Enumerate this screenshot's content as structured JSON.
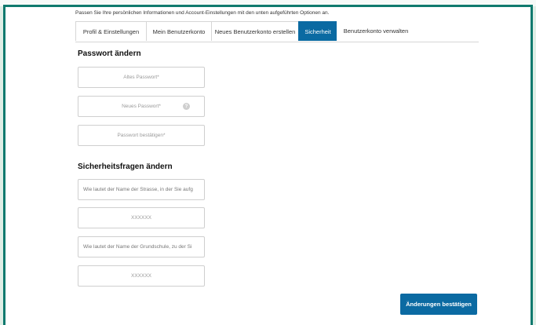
{
  "intro_text": "Passen Sie Ihre persönlichen Informationen und Account-Einstellungen mit den unten aufgeführten Optionen an.",
  "tabs": [
    {
      "label": "Profil & Einstellungen"
    },
    {
      "label": "Mein Benutzerkonto"
    },
    {
      "label": "Neues Benutzerkonto erstellen"
    },
    {
      "label": "Sicherheit",
      "active": true
    },
    {
      "label": "Benutzerkonto verwalten"
    }
  ],
  "password_section": {
    "title": "Passwort ändern",
    "old_password_placeholder": "Altes Passwort*",
    "new_password_placeholder": "Neues Passwort*",
    "confirm_password_placeholder": "Passwort bestätigen*",
    "help_glyph": "?"
  },
  "security_section": {
    "title": "Sicherheitsfragen ändern",
    "question1": "Wie lautet der Name der Strasse, in der Sie aufg",
    "answer1": "XXXXXX",
    "question2": "Wie lautet der Name der Grundschule, zu der Si",
    "answer2": "XXXXXX"
  },
  "confirm_button_label": "Änderungen bestätigen",
  "colors": {
    "accent": "#0b6aa2",
    "frame": "#0f7a6e",
    "background": "#dfeee6"
  }
}
